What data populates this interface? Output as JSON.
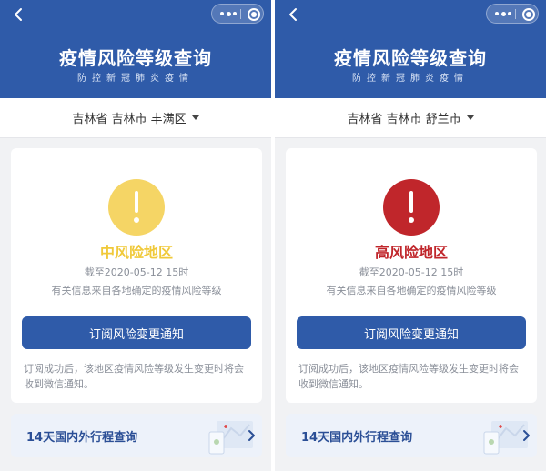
{
  "colors": {
    "header_bg": "#2f5ba9",
    "button_bg": "#2f5ba9",
    "medium_risk": "#f5d565",
    "medium_risk_text": "#f0c93a",
    "high_risk": "#c0262b",
    "high_risk_text": "#c0262b"
  },
  "panels": [
    {
      "header": {
        "title": "疫情风险等级查询",
        "subtitle": "防控新冠肺炎疫情"
      },
      "location": "吉林省 吉林市 丰满区",
      "risk": {
        "icon": "exclamation-icon",
        "label": "中风险地区",
        "timestamp": "截至2020-05-12 15时",
        "source_note": "有关信息来自各地确定的疫情风险等级"
      },
      "subscribe_label": "订阅风险变更通知",
      "subscribe_note": "订阅成功后，该地区疫情风险等级发生变更时将会收到微信通知。",
      "travel_label": "14天国内外行程查询"
    },
    {
      "header": {
        "title": "疫情风险等级查询",
        "subtitle": "防控新冠肺炎疫情"
      },
      "location": "吉林省 吉林市 舒兰市",
      "risk": {
        "icon": "exclamation-icon",
        "label": "高风险地区",
        "timestamp": "截至2020-05-12 15时",
        "source_note": "有关信息来自各地确定的疫情风险等级"
      },
      "subscribe_label": "订阅风险变更通知",
      "subscribe_note": "订阅成功后，该地区疫情风险等级发生变更时将会收到微信通知。",
      "travel_label": "14天国内外行程查询"
    }
  ]
}
